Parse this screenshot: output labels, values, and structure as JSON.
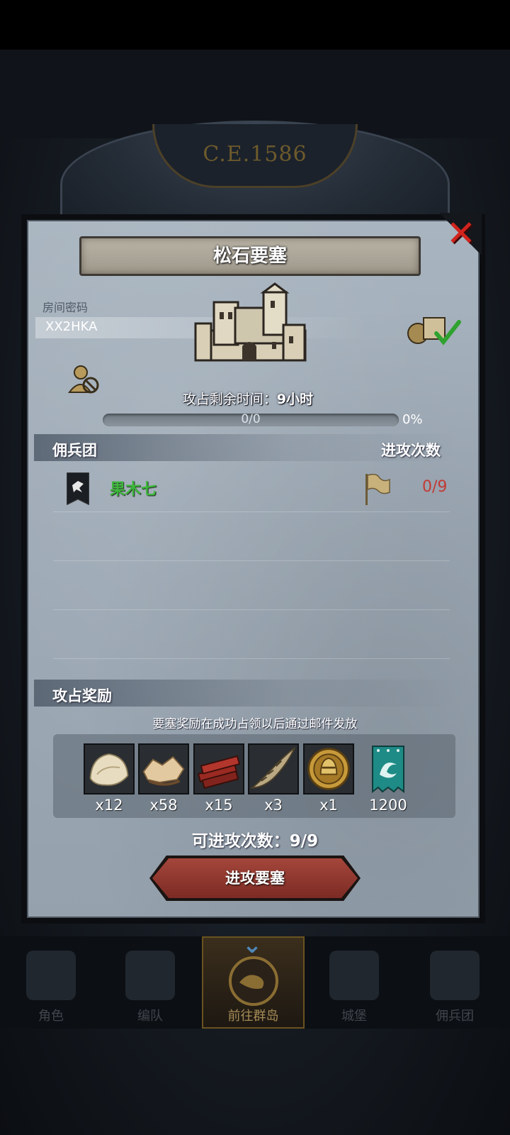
{
  "header": {
    "year": "C.E.1586"
  },
  "modal": {
    "title": "松石要塞",
    "room_label": "房间密码",
    "room_code": "XX2HKA",
    "occupy_time_label": "攻占剩余时间：",
    "occupy_time_value": "9小时",
    "progress": {
      "text": "0/0",
      "percent_label": "0%",
      "fraction": 0
    },
    "mercenary_header": "佣兵团",
    "attack_header": "进攻次数",
    "guilds": [
      {
        "name": "果木七",
        "attacks": "0/9"
      }
    ],
    "reward_header": "攻占奖励",
    "reward_note": "要塞奖励在成功占领以后通过邮件发放",
    "rewards": [
      {
        "icon": "fur-icon",
        "qty": "x12"
      },
      {
        "icon": "hide-icon",
        "qty": "x58"
      },
      {
        "icon": "wood-planks-icon",
        "qty": "x15"
      },
      {
        "icon": "horn-icon",
        "qty": "x3"
      },
      {
        "icon": "knight-helmet-coin-icon",
        "qty": "x1"
      },
      {
        "icon": "guild-banner-icon",
        "qty": "1200"
      }
    ],
    "attacks_left": "可进攻次数：9/9",
    "attack_button": "进攻要塞"
  },
  "nav": {
    "items": [
      {
        "label": "角色"
      },
      {
        "label": "编队"
      },
      {
        "label": "前往群岛"
      },
      {
        "label": "城堡"
      },
      {
        "label": "佣兵团"
      }
    ]
  },
  "colors": {
    "guild_name": "#3db63b",
    "attack_count": "#c23a35",
    "button": "#8f372e"
  }
}
